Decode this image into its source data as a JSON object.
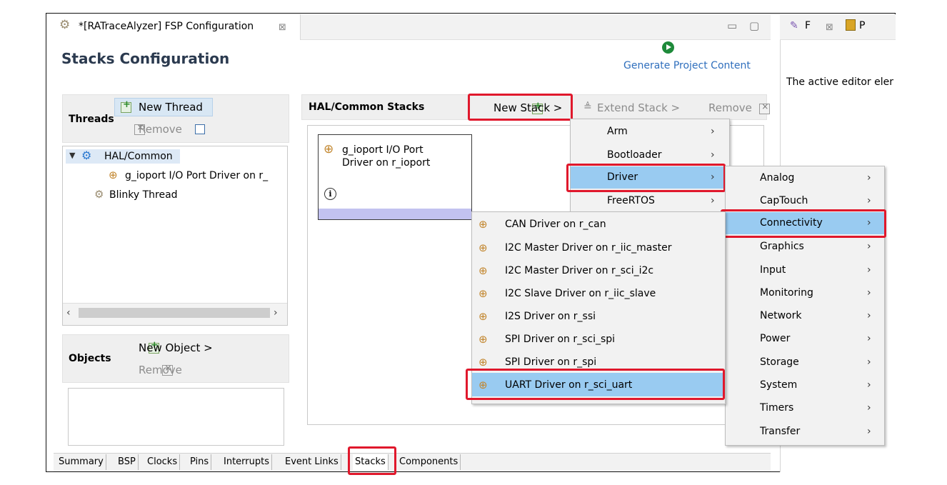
{
  "editor": {
    "tab_title": "*[RATraceAlyzer] FSP Configuration",
    "tab_close": "⊠",
    "minimize": "▭",
    "maximize": "▢",
    "page_title": "Stacks Configuration",
    "generate_label": "Generate Project Content"
  },
  "side_panel": {
    "tab1": "F",
    "tab2": "P",
    "tab_close": "⊠",
    "text": "The active editor eler"
  },
  "threads": {
    "label": "Threads",
    "new_thread": "New Thread",
    "remove": "Remove",
    "tree": [
      "HAL/Common",
      "g_ioport I/O Port Driver on r_",
      "Blinky Thread"
    ]
  },
  "objects": {
    "label": "Objects",
    "new_object": "New Object >",
    "remove": "Remove"
  },
  "hal": {
    "label": "HAL/Common Stacks",
    "new_stack": "New Stack >",
    "extend_stack": "Extend Stack >",
    "remove": "Remove",
    "card_line1": "g_ioport I/O Port",
    "card_line2": "Driver on r_ioport"
  },
  "menu1": [
    "Arm",
    "Bootloader",
    "Driver",
    "FreeRTOS"
  ],
  "menu2": [
    "Analog",
    "CapTouch",
    "Connectivity",
    "Graphics",
    "Input",
    "Monitoring",
    "Network",
    "Power",
    "Storage",
    "System",
    "Timers",
    "Transfer"
  ],
  "menu3": [
    "CAN Driver on r_can",
    "I2C Master Driver on r_iic_master",
    "I2C Master Driver on r_sci_i2c",
    "I2C Slave Driver on r_iic_slave",
    "I2S Driver on r_ssi",
    "SPI Driver on r_sci_spi",
    "SPI Driver on r_spi",
    "UART Driver on r_sci_uart"
  ],
  "bottom_tabs": [
    "Summary",
    "BSP",
    "Clocks",
    "Pins",
    "Interrupts",
    "Event Links",
    "Stacks",
    "Components"
  ],
  "colors": {
    "highlight": "#99cbf1",
    "callout": "#e0182c",
    "link": "#2f6fbd"
  }
}
